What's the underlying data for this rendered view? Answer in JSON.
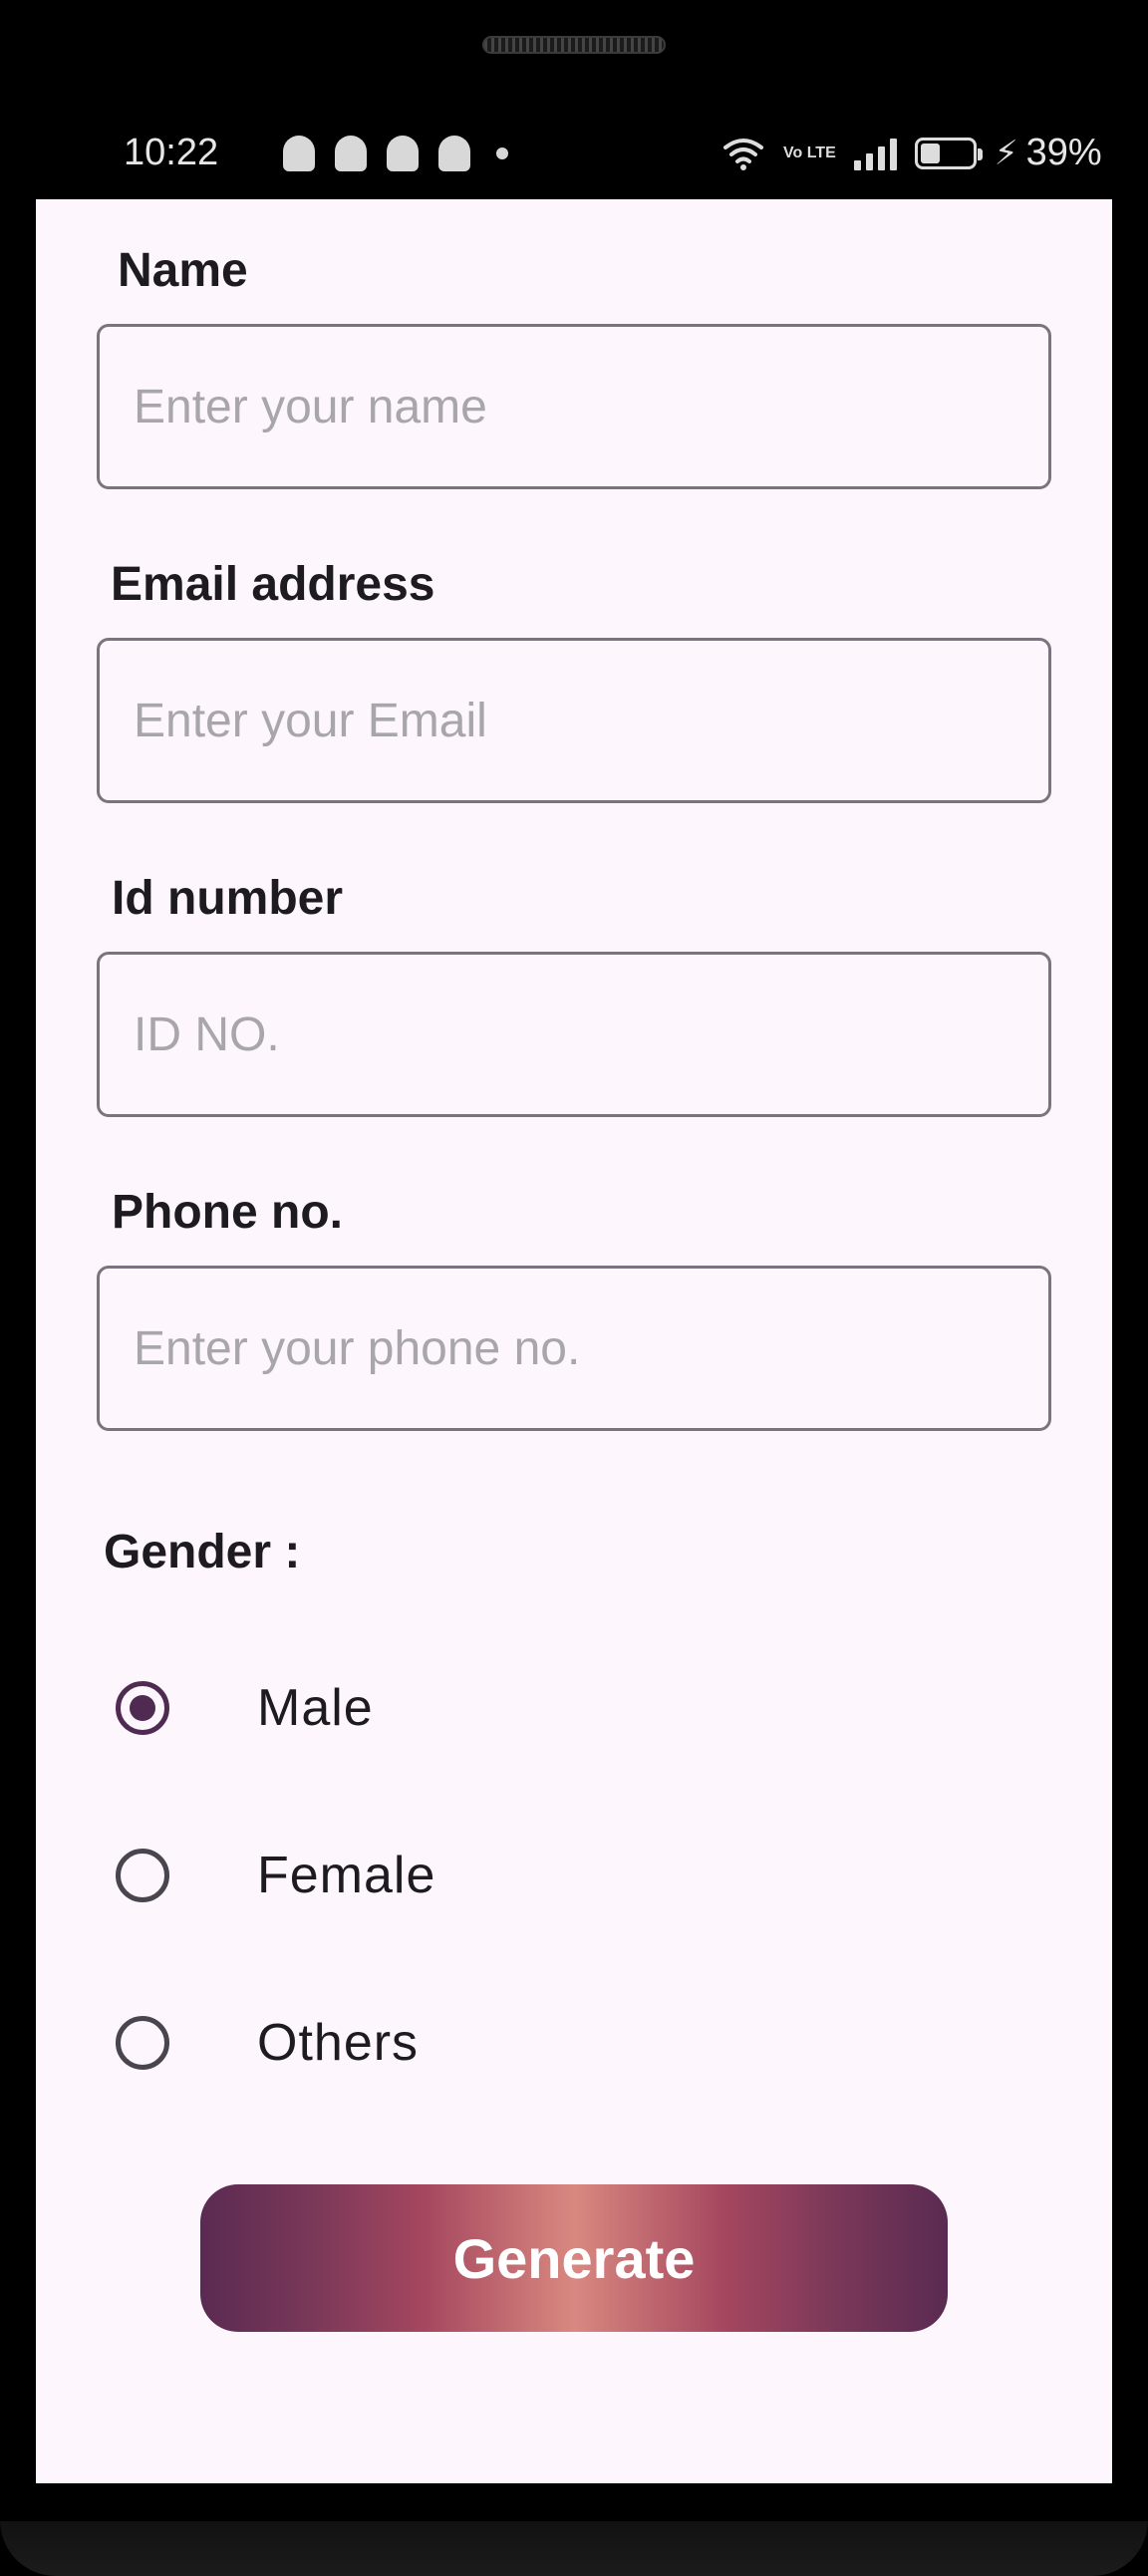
{
  "status_bar": {
    "time": "10:22",
    "notification_icons": [
      "snapchat-icon",
      "snapchat-icon",
      "snapchat-icon",
      "snapchat-icon",
      "more-dot-icon"
    ],
    "network_label": "Vo LTE",
    "battery_percent": "39%",
    "battery_level": 0.39,
    "charging": true
  },
  "form": {
    "name": {
      "label": "Name",
      "placeholder": "Enter your name"
    },
    "email": {
      "label": "Email address",
      "placeholder": "Enter your Email"
    },
    "id_number": {
      "label": "Id number",
      "placeholder": "ID NO."
    },
    "phone": {
      "label": "Phone no.",
      "placeholder": "Enter your phone no."
    },
    "gender": {
      "label": "Gender  :",
      "options": [
        {
          "label": "Male",
          "selected": true
        },
        {
          "label": "Female",
          "selected": false
        },
        {
          "label": "Others",
          "selected": false
        }
      ]
    },
    "submit_label": "Generate"
  },
  "colors": {
    "accent": "#4f2b52",
    "button_gradient": [
      "#5a2a52",
      "#a5475f",
      "#d98880"
    ],
    "background": "#fdf7fd"
  }
}
